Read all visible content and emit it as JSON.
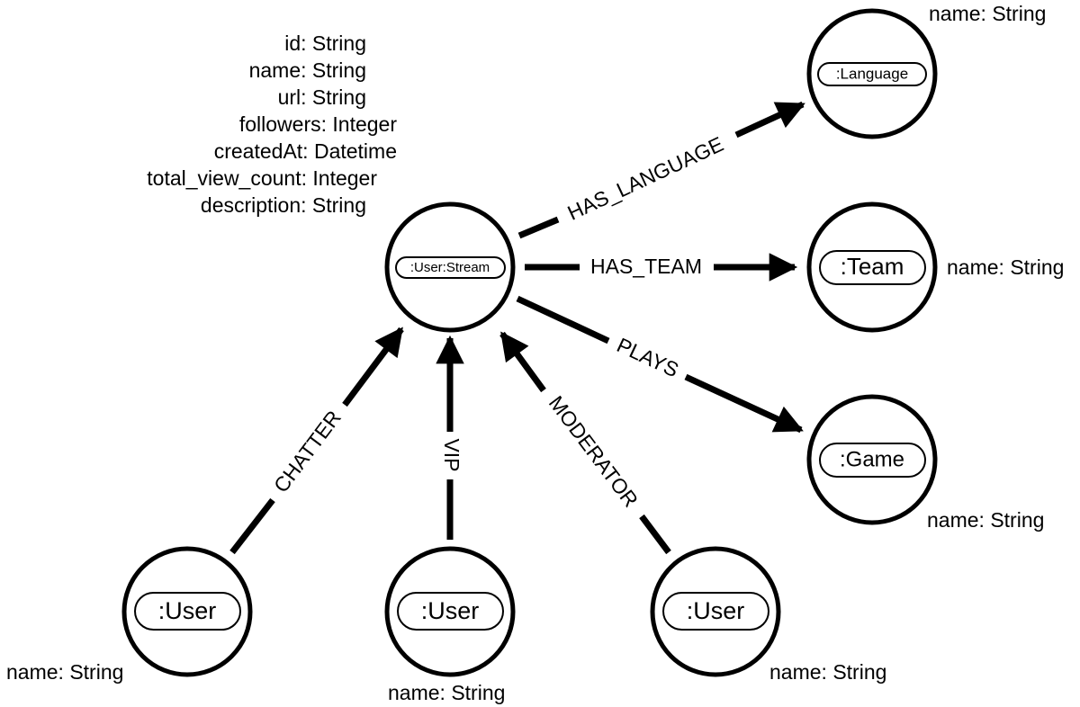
{
  "diagram": {
    "nodes": [
      {
        "id": "stream",
        "label": ":User:Stream",
        "properties": [
          "id: String",
          "name: String",
          "url: String",
          "followers: Integer",
          "createdAt: Datetime",
          "total_view_count: Integer",
          "description: String"
        ]
      },
      {
        "id": "language",
        "label": ":Language",
        "properties": [
          "name: String"
        ]
      },
      {
        "id": "team",
        "label": ":Team",
        "properties": [
          "name: String"
        ]
      },
      {
        "id": "game",
        "label": ":Game",
        "properties": [
          "name: String"
        ]
      },
      {
        "id": "user_chatter",
        "label": ":User",
        "properties": [
          "name: String"
        ]
      },
      {
        "id": "user_vip",
        "label": ":User",
        "properties": [
          "name: String"
        ]
      },
      {
        "id": "user_moderator",
        "label": ":User",
        "properties": [
          "name: String"
        ]
      }
    ],
    "edges": [
      {
        "from": "stream",
        "to": "language",
        "label": "HAS_LANGUAGE"
      },
      {
        "from": "stream",
        "to": "team",
        "label": "HAS_TEAM"
      },
      {
        "from": "stream",
        "to": "game",
        "label": "PLAYS"
      },
      {
        "from": "user_chatter",
        "to": "stream",
        "label": "CHATTER"
      },
      {
        "from": "user_vip",
        "to": "stream",
        "label": "VIP"
      },
      {
        "from": "user_moderator",
        "to": "stream",
        "label": "MODERATOR"
      }
    ]
  }
}
